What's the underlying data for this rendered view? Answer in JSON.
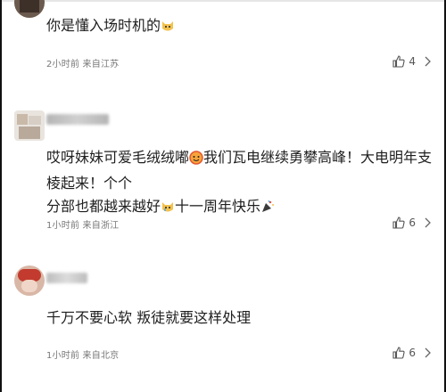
{
  "comments": [
    {
      "text": "你是懂入场时机的",
      "emoji": "cat-face-emoji",
      "meta": "2小时前 来自江苏",
      "likes": "4"
    },
    {
      "text_line1_a": "哎呀妹妹可爱毛绒绒嘟",
      "text_line1_b": "我们瓦电继续勇攀高峰！大电明年支棱起来！个个",
      "text_line2_a": "分部也都越来越好",
      "text_line2_b": "十一周年快乐",
      "emojis": [
        "smiling-face-with-hearts-emoji",
        "crying-cat-emoji",
        "party-popper-emoji"
      ],
      "meta": "1小时前 来自浙江",
      "likes": "6"
    },
    {
      "text": "千万不要心软 叛徒就要这样处理",
      "meta": "1小时前 来自北京",
      "likes": "6"
    }
  ],
  "icons": {
    "like": "thumbs-up-icon",
    "more": "chevron-right-icon"
  },
  "colors": {
    "meta_text": "#777777",
    "body_text": "#1f1f1f"
  }
}
